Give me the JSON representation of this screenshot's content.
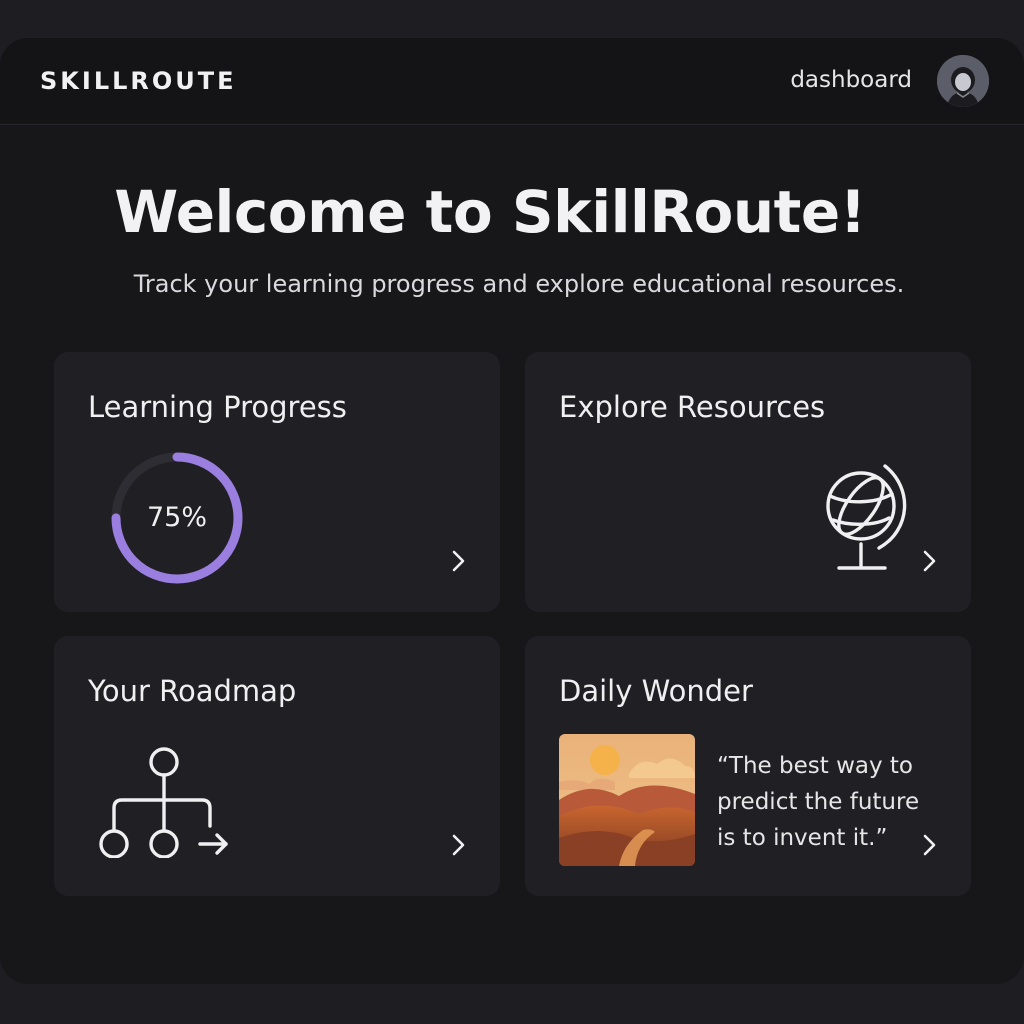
{
  "header": {
    "brand": "SKILLROUTE",
    "nav_link": "dashboard",
    "avatar_icon": "user-avatar-icon"
  },
  "hero": {
    "title": "Welcome to SkillRoute!",
    "subtitle": "Track your learning progress and explore educational resources."
  },
  "cards": {
    "progress": {
      "title": "Learning Progress",
      "value_label": "75%",
      "value": 0.75,
      "accent_color": "#9b7fe0",
      "icon": "chevron-right-icon"
    },
    "resources": {
      "title": "Explore Resources",
      "icon": "globe-icon"
    },
    "roadmap": {
      "title": "Your Roadmap",
      "icon": "roadmap-tree-icon"
    },
    "wonder": {
      "title": "Daily Wonder",
      "quote": "“The best way to predict the future is to invent it.”",
      "image": "sunset-landscape-image"
    }
  },
  "colors": {
    "background": "#17171a",
    "card": "#202024",
    "accent": "#9b7fe0"
  }
}
